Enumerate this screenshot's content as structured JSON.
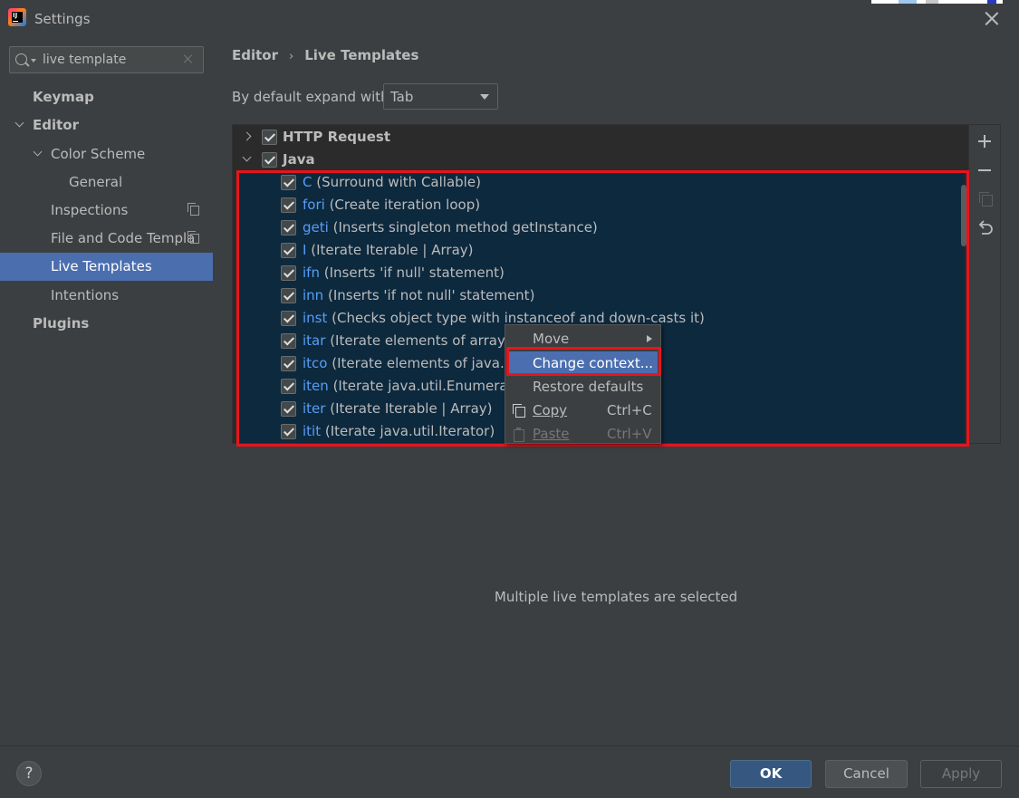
{
  "window": {
    "title": "Settings"
  },
  "search": {
    "value": "live template",
    "placeholder": ""
  },
  "sidebar": {
    "items": [
      {
        "label": "Keymap"
      },
      {
        "label": "Editor"
      },
      {
        "label": "Color Scheme"
      },
      {
        "label": "General"
      },
      {
        "label": "Inspections"
      },
      {
        "label": "File and Code Templa"
      },
      {
        "label": "Live Templates"
      },
      {
        "label": "Intentions"
      },
      {
        "label": "Plugins"
      }
    ]
  },
  "breadcrumb": {
    "parent": "Editor",
    "separator": "›",
    "current": "Live Templates"
  },
  "expand": {
    "label": "By default expand with",
    "value": "Tab"
  },
  "template_groups": [
    {
      "name": "HTTP Request",
      "checked": true,
      "expanded": false
    },
    {
      "name": "Java",
      "checked": true,
      "expanded": true
    }
  ],
  "templates": [
    {
      "abbr": "C",
      "desc": "(Surround with Callable)"
    },
    {
      "abbr": "fori",
      "desc": "(Create iteration loop)"
    },
    {
      "abbr": "geti",
      "desc": "(Inserts singleton method getInstance)"
    },
    {
      "abbr": "I",
      "desc": "(Iterate Iterable | Array)"
    },
    {
      "abbr": "ifn",
      "desc": "(Inserts 'if null' statement)"
    },
    {
      "abbr": "inn",
      "desc": "(Inserts 'if not null' statement)"
    },
    {
      "abbr": "inst",
      "desc": "(Checks object type with instanceof and down-casts it)"
    },
    {
      "abbr": "itar",
      "desc": "(Iterate elements of array)"
    },
    {
      "abbr": "itco",
      "desc": "(Iterate elements of java.util."
    },
    {
      "abbr": "iten",
      "desc": "(Iterate java.util.Enumeration"
    },
    {
      "abbr": "iter",
      "desc": "(Iterate Iterable | Array)"
    },
    {
      "abbr": "itit",
      "desc": "(Iterate java.util.Iterator)"
    }
  ],
  "context_menu": {
    "items": [
      {
        "label": "Move",
        "shortcut": ""
      },
      {
        "label": "Change context...",
        "shortcut": ""
      },
      {
        "label": "Restore defaults",
        "shortcut": ""
      },
      {
        "label": "Copy",
        "shortcut": "Ctrl+C"
      },
      {
        "label": "Paste",
        "shortcut": "Ctrl+V"
      }
    ]
  },
  "info": {
    "text": "Multiple live templates are selected"
  },
  "buttons": {
    "help": "?",
    "ok": "OK",
    "cancel": "Cancel",
    "apply": "Apply"
  },
  "colors": {
    "accent": "#4b6eaf",
    "selection": "#0d293e",
    "annotation": "#e8141c",
    "link": "#589df6"
  }
}
